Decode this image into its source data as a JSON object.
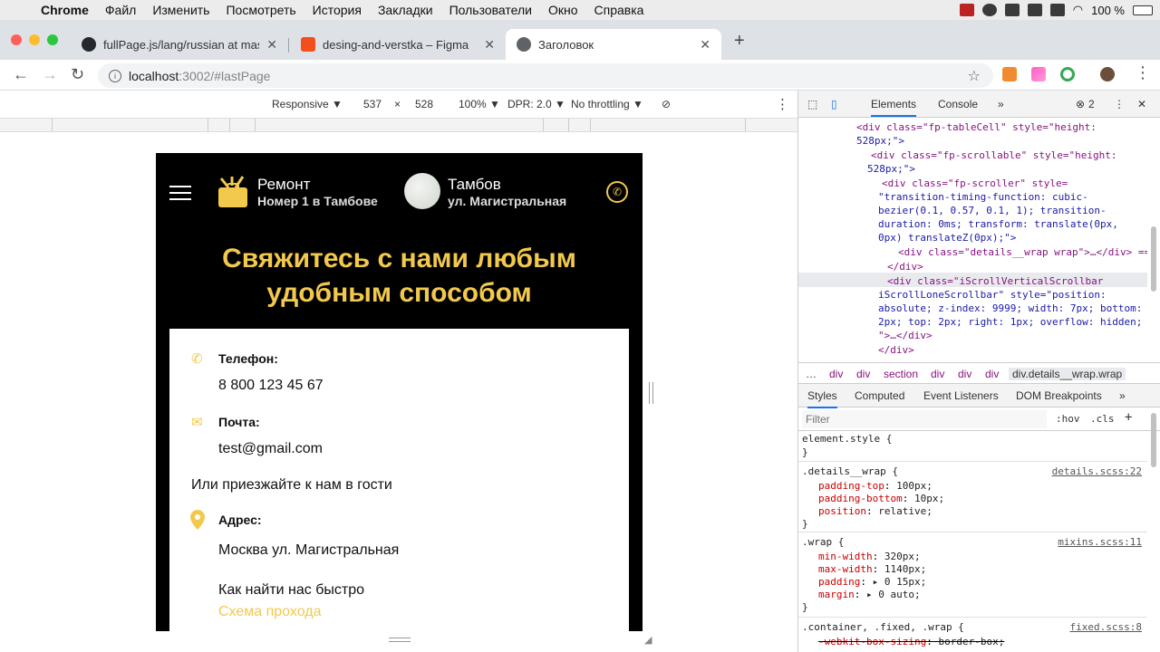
{
  "menubar": {
    "app": "Chrome",
    "items": [
      "Файл",
      "Изменить",
      "Посмотреть",
      "История",
      "Закладки",
      "Пользователи",
      "Окно",
      "Справка"
    ],
    "battery": "100 %"
  },
  "tabs": [
    {
      "title": "fullPage.js/lang/russian at mas",
      "favicon_color": "#24292e"
    },
    {
      "title": "desing-and-verstka – Figma",
      "favicon_color": "#f24e1e"
    },
    {
      "title": "Заголовок",
      "favicon_color": "#5f6368"
    }
  ],
  "address": {
    "host": "localhost",
    "path": ":3002/#lastPage"
  },
  "device_toolbar": {
    "mode": "Responsive ▼",
    "width": "537",
    "x": "×",
    "height": "528",
    "zoom": "100% ▼",
    "dpr": "DPR: 2.0 ▼",
    "throttling": "No throttling ▼"
  },
  "site": {
    "brand_name": "Ремонт",
    "brand_sub": "Номер 1 в Тамбове",
    "city": "Тамбов",
    "street": "ул. Магистральная",
    "title_line1": "Свяжитесь с нами любым",
    "title_line2": "удобным способом",
    "phone_label": "Телефон:",
    "phone_value": "8 800 123 45 67",
    "mail_label": "Почта:",
    "mail_value": "test@gmail.com",
    "visit_text": "Или приезжайте к нам в гости",
    "address_label": "Адрес:",
    "address_value": "Москва ул. Магистральная",
    "find_text": "Как найти нас быстро",
    "scheme_link": "Схема прохода",
    "accent_color": "#f2c94c"
  },
  "devtools": {
    "tabs": [
      "Elements",
      "Console",
      "»"
    ],
    "error_count": "2",
    "dom_lines": [
      "<div class=\"fp-tableCell\" style=\"height:",
      "528px;\">",
      "<div class=\"fp-scrollable\" style=\"height:",
      "528px;\">",
      "<div class=\"fp-scroller\" style=",
      "\"transition-timing-function: cubic-",
      "bezier(0.1, 0.57, 0.1, 1); transition-",
      "duration: 0ms; transform: translate(0px,",
      "0px) translateZ(0px);\">",
      "<div class=\"details__wrap wrap\">…</div> ==",
      "</div>",
      "<div class=\"iScrollVerticalScrollbar",
      "iScrollLoneScrollbar\" style=\"position:",
      "absolute; z-index: 9999; width: 7px; bottom:",
      "2px; top: 2px; right: 1px; overflow: hidden;",
      "\">…</div>",
      "</div>"
    ],
    "breadcrumbs": [
      "…",
      "div",
      "div",
      "section",
      "div",
      "div",
      "div",
      "div.details__wrap.wrap"
    ],
    "style_tabs": [
      "Styles",
      "Computed",
      "Event Listeners",
      "DOM Breakpoints",
      "»"
    ],
    "filter_placeholder": "Filter",
    "hov": ":hov",
    "cls": ".cls",
    "plus": "+",
    "rules": [
      {
        "selector": "element.style {",
        "source": "",
        "props": [],
        "close": "}"
      },
      {
        "selector": ".details__wrap {",
        "source": "details.scss:22",
        "props": [
          [
            "padding-top",
            "100px;"
          ],
          [
            "padding-bottom",
            "10px;"
          ],
          [
            "position",
            "relative;"
          ]
        ],
        "close": "}"
      },
      {
        "selector": ".wrap {",
        "source": "mixins.scss:11",
        "props": [
          [
            "min-width",
            "320px;"
          ],
          [
            "max-width",
            "1140px;"
          ],
          [
            "padding",
            "▸ 0 15px;"
          ],
          [
            "margin",
            "▸ 0 auto;"
          ]
        ],
        "close": "}"
      },
      {
        "selector": ".container, .fixed, .wrap {",
        "source": "fixed.scss:8",
        "props": [
          [
            "-webkit-box-sizing",
            "border-box;"
          ]
        ],
        "close": ""
      }
    ]
  }
}
